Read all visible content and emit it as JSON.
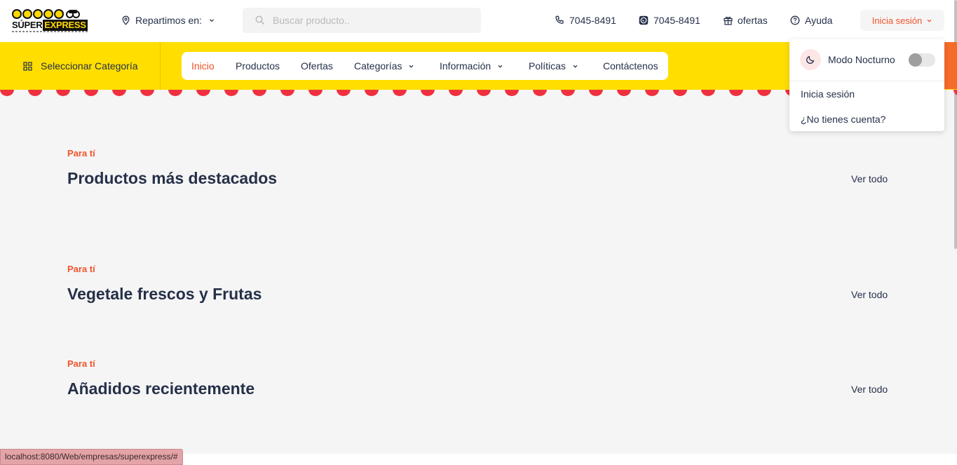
{
  "brand": {
    "logo_word_a": "SÚPER",
    "logo_word_b": "EXPRESS"
  },
  "header": {
    "delivery_label": "Repartimos en:",
    "search_placeholder": "Buscar producto..",
    "phone": "7045-8491",
    "whatsapp": "7045-8491",
    "offers": "ofertas",
    "help": "Ayuda",
    "login": "Inicia sesión"
  },
  "nav": {
    "category_select": "Seleccionar Categoría",
    "items": [
      {
        "label": "Inicio",
        "active": true
      },
      {
        "label": "Productos"
      },
      {
        "label": "Ofertas"
      },
      {
        "label": "Categorías",
        "has_dropdown": true
      },
      {
        "label": "Información",
        "has_dropdown": true
      },
      {
        "label": "Políticas",
        "has_dropdown": true
      },
      {
        "label": "Contáctenos"
      }
    ]
  },
  "sections": [
    {
      "eyebrow": "Para tí",
      "title": "Productos más destacados",
      "link": "Ver todo"
    },
    {
      "eyebrow": "Para tí",
      "title": "Vegetale frescos y Frutas",
      "link": "Ver todo"
    },
    {
      "eyebrow": "Para tí",
      "title": "Añadidos recientemente",
      "link": "Ver todo"
    }
  ],
  "account_menu": {
    "night_mode": "Modo Nocturno",
    "night_mode_on": false,
    "login": "Inicia sesión",
    "register": "¿No tienes cuenta?"
  },
  "status_bar": {
    "url": "localhost:8080/Web/empresas/superexpress/#"
  },
  "colors": {
    "accent": "#f0532b",
    "nav_yellow": "#ffde00",
    "scallop_red": "#f0303f",
    "text": "#253049"
  }
}
